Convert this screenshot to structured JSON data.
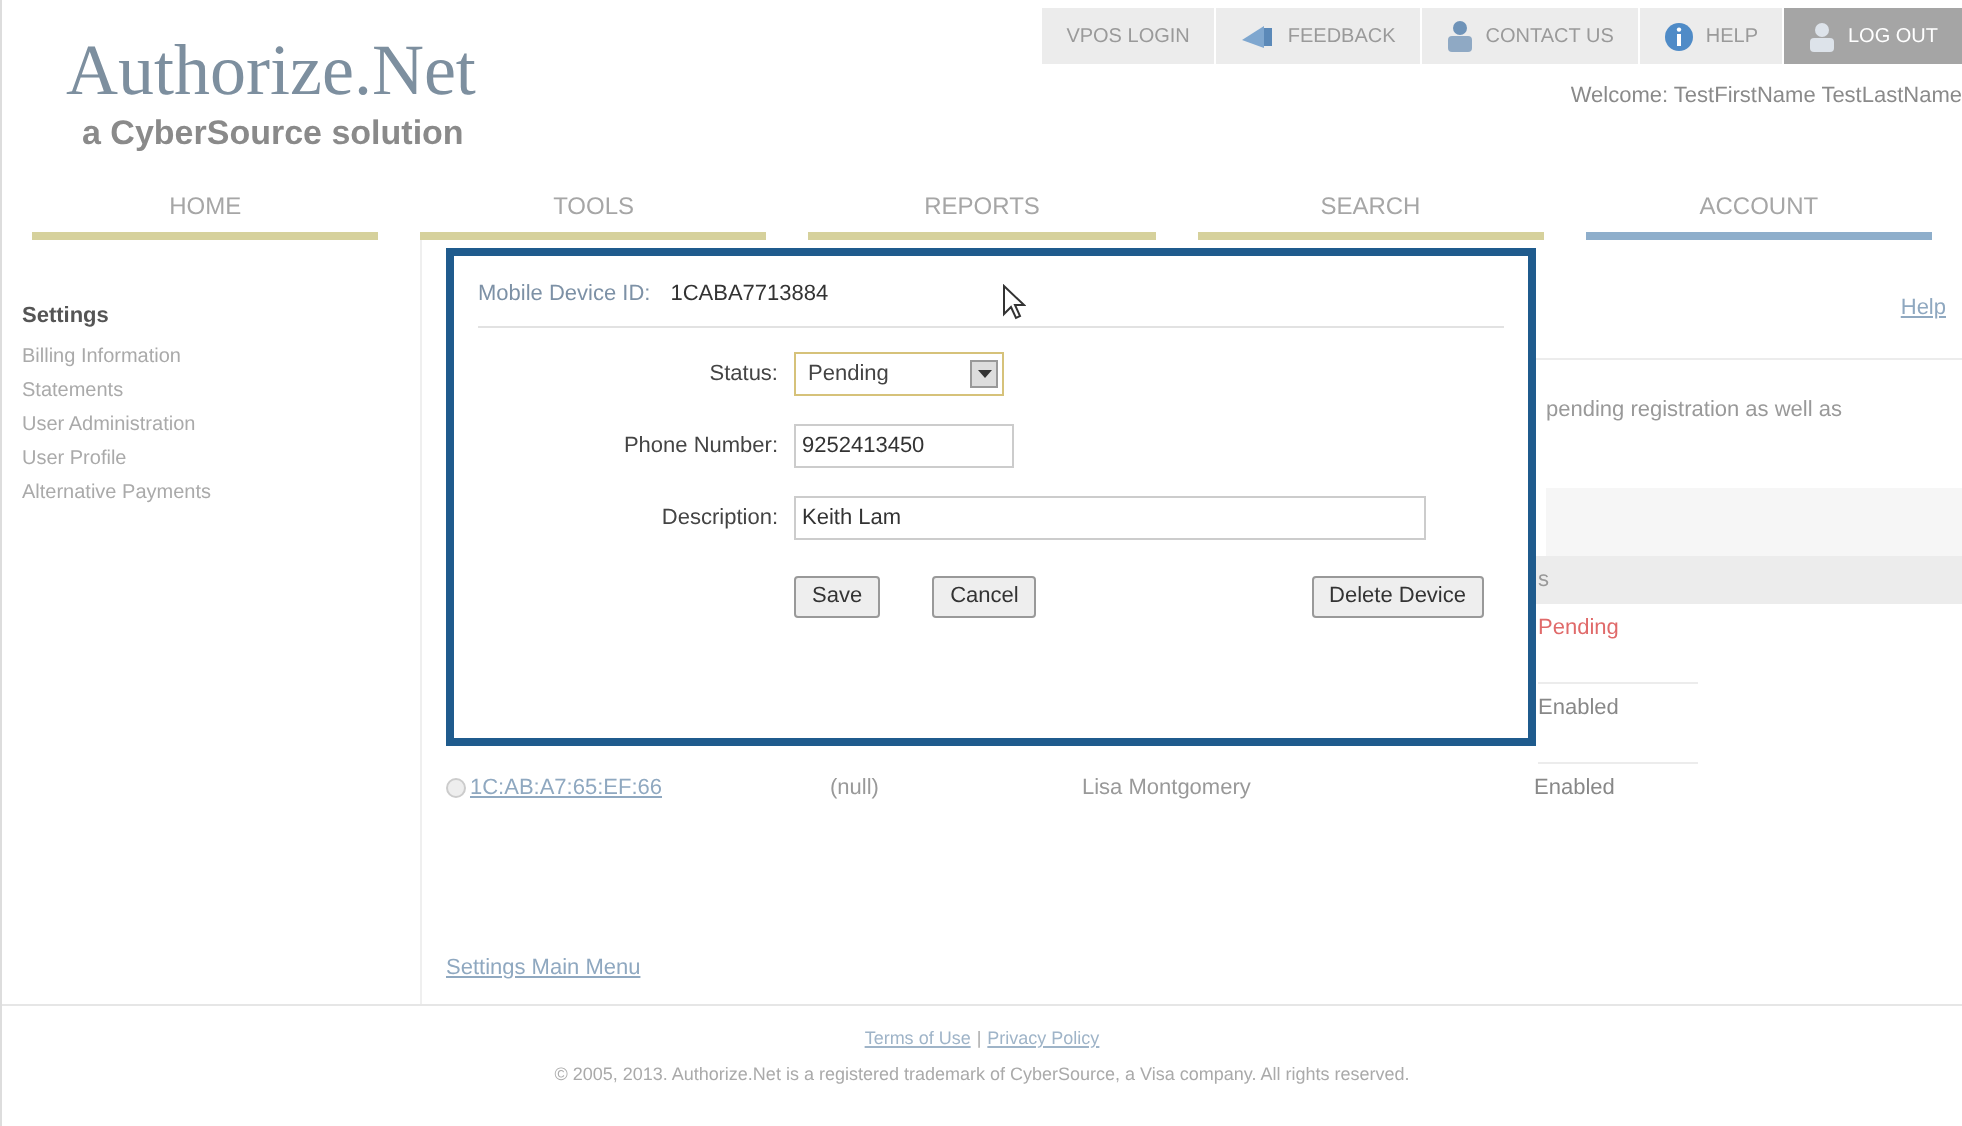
{
  "logo": {
    "name": "Authorize.Net",
    "tagline": "a CyberSource solution"
  },
  "top_links": [
    {
      "label": "VPOS LOGIN",
      "kind": "plain"
    },
    {
      "label": "FEEDBACK",
      "kind": "feedback"
    },
    {
      "label": "CONTACT US",
      "kind": "contact"
    },
    {
      "label": "HELP",
      "kind": "help"
    },
    {
      "label": "LOG OUT",
      "kind": "logout"
    }
  ],
  "welcome": "Welcome: TestFirstName TestLastName",
  "nav_tabs": [
    {
      "label": "HOME",
      "selected": false
    },
    {
      "label": "TOOLS",
      "selected": false
    },
    {
      "label": "REPORTS",
      "selected": false
    },
    {
      "label": "SEARCH",
      "selected": false
    },
    {
      "label": "ACCOUNT",
      "selected": true
    }
  ],
  "sidebar": {
    "items": [
      {
        "label": "Settings",
        "selected": true
      },
      {
        "label": "Billing Information",
        "selected": false
      },
      {
        "label": "Statements",
        "selected": false
      },
      {
        "label": "User Administration",
        "selected": false
      },
      {
        "label": "User Profile",
        "selected": false
      },
      {
        "label": "Alternative Payments",
        "selected": false
      }
    ]
  },
  "content": {
    "help_link": "Help",
    "intro_fragment": "pending registration as well as",
    "table_header_fragment": "s",
    "row_fragments": [
      {
        "status": "Pending",
        "kind": "pending"
      },
      {
        "status": "Enabled",
        "kind": "enabled"
      }
    ],
    "rows": [
      {
        "device_id": "1C:AB:A7:65:EF:66",
        "column_2": "(null)",
        "column_3": "Lisa Montgomery",
        "status": "Enabled",
        "selected": false
      }
    ],
    "main_menu_link": "Settings Main Menu"
  },
  "dialog": {
    "device_id_label": "Mobile Device ID:",
    "device_id": "1CABA7713884",
    "status_label": "Status:",
    "status_value": "Pending",
    "phone_label": "Phone Number:",
    "phone_value": "9252413450",
    "description_label": "Description:",
    "description_value": "Keith Lam",
    "buttons": [
      "Save",
      "Cancel",
      "Delete Device"
    ]
  },
  "footer": {
    "links": [
      "Terms of Use",
      "Privacy Policy"
    ],
    "separator": "|",
    "copyright": "© 2005, 2013. Authorize.Net is a registered trademark of CyberSource, a Visa company. All rights reserved."
  }
}
